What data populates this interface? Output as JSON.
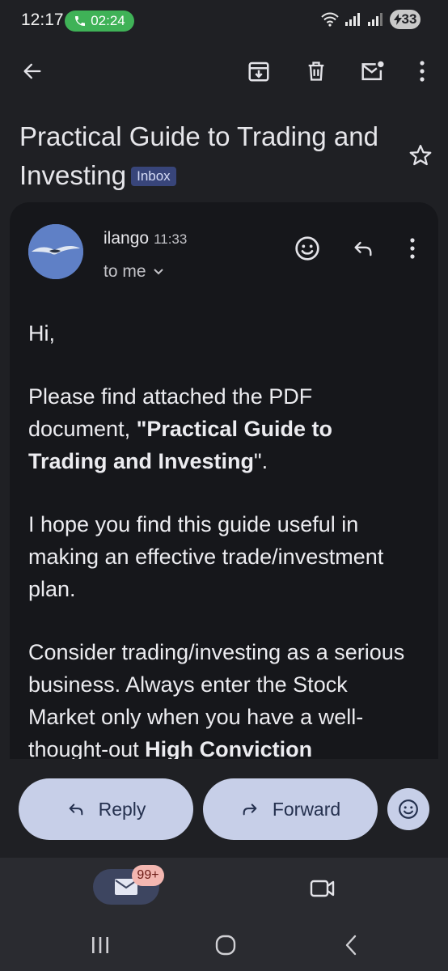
{
  "status_bar": {
    "time": "12:17",
    "call_timer": "02:24",
    "battery": "33"
  },
  "app_bar": {
    "icons": [
      "back-arrow-icon",
      "archive-icon",
      "delete-icon",
      "mark-unread-icon",
      "more-vert-icon"
    ]
  },
  "email": {
    "subject": "Practical Guide to Trading and Investing",
    "label_chip": "Inbox",
    "sender": "ilango",
    "time": "11:33",
    "recipients": "to me",
    "body": {
      "greeting": "Hi,",
      "p1_before": "Please find attached the PDF document, ",
      "p1_bold": "\"Practical Guide to Trading and Investing",
      "p1_after": "\".",
      "p2": "I hope you find this guide useful in making an effective trade/investment plan.",
      "p3_before": "Consider trading/investing as a serious business. Always enter the Stock Market only when you have a well-thought-out ",
      "p3_bold": "High Conviction"
    }
  },
  "actions": {
    "reply_label": "Reply",
    "forward_label": "Forward"
  },
  "bottom_nav": {
    "mail_badge": "99+"
  },
  "colors": {
    "background": "#1f2024",
    "card": "#16171b",
    "pill_button": "#c7cfe8",
    "call_pill": "#3fb257",
    "inbox_chip": "#38457a",
    "badge": "#f3b7b1"
  }
}
